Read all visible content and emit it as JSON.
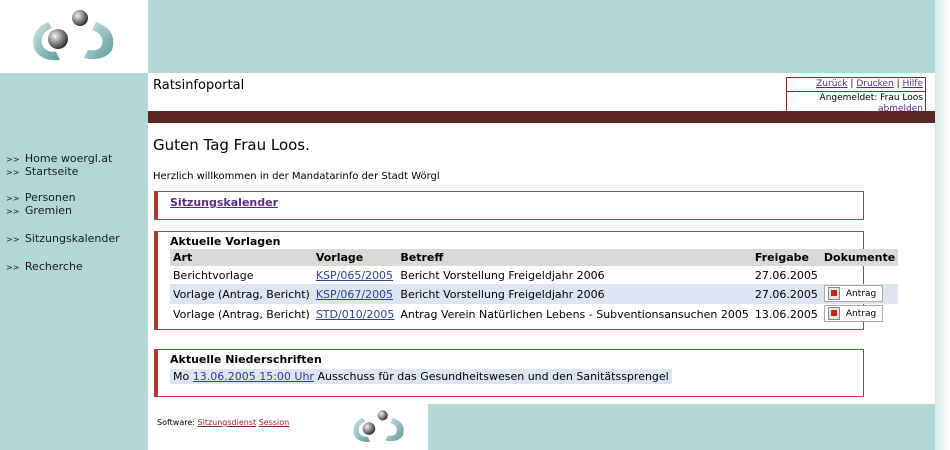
{
  "header": {
    "logo_icon": "recycling-balls-logo-icon"
  },
  "app": {
    "title": "Ratsinfoportal"
  },
  "toolbox": {
    "back": "Zurück",
    "print": "Drucken",
    "help": "Hilfe",
    "logged_in_label": "Angemeldet: Frau Loos",
    "logout": "abmelden"
  },
  "sidebar": {
    "items": [
      {
        "label": "Home woergl.at"
      },
      {
        "label": "Startseite"
      },
      {
        "label": "Personen"
      },
      {
        "label": "Gremien"
      },
      {
        "label": "Sitzungskalender"
      },
      {
        "label": "Recherche"
      }
    ]
  },
  "main": {
    "greeting": "Guten Tag Frau Loos.",
    "welcome": "Herzlich willkommen in der Mandatarinfo der Stadt Wörgl",
    "calendar_link": "Sitzungskalender",
    "vorlagen": {
      "title": "Aktuelle Vorlagen",
      "headers": [
        "Art",
        "Vorlage",
        "Betreff",
        "Freigabe",
        "Dokumente"
      ],
      "rows": [
        {
          "art": "Berichtvorlage",
          "vorlage": "KSP/065/2005",
          "betreff": "Bericht Vorstellung Freigeldjahr 2006",
          "freigabe": "27.06.2005",
          "dokument": ""
        },
        {
          "art": "Vorlage (Antrag, Bericht)",
          "vorlage": "KSP/067/2005",
          "betreff": "Bericht Vorstellung Freigeldjahr 2006",
          "freigabe": "27.06.2005",
          "dokument": "Antrag"
        },
        {
          "art": "Vorlage (Antrag, Bericht)",
          "vorlage": "STD/010/2005",
          "betreff": "Antrag Verein Natürlichen Lebens - Subventionsansuchen 2005",
          "freigabe": "13.06.2005",
          "dokument": "Antrag"
        }
      ]
    },
    "niederschriften": {
      "title": "Aktuelle Niederschriften",
      "day": "Mo",
      "date_link": "13.06.2005 15:00 Uhr",
      "text": "Ausschuss für das Gesundheitswesen und den Sanitätssprengel"
    }
  },
  "footer": {
    "software_label": "Software:",
    "link1": "Sitzungsdienst",
    "link2": "Session"
  },
  "colors": {
    "teal": "#b2d7d7",
    "brown_bar": "#5a2824",
    "box_border": "#b23a30",
    "row_alt": "#dde5f2"
  }
}
